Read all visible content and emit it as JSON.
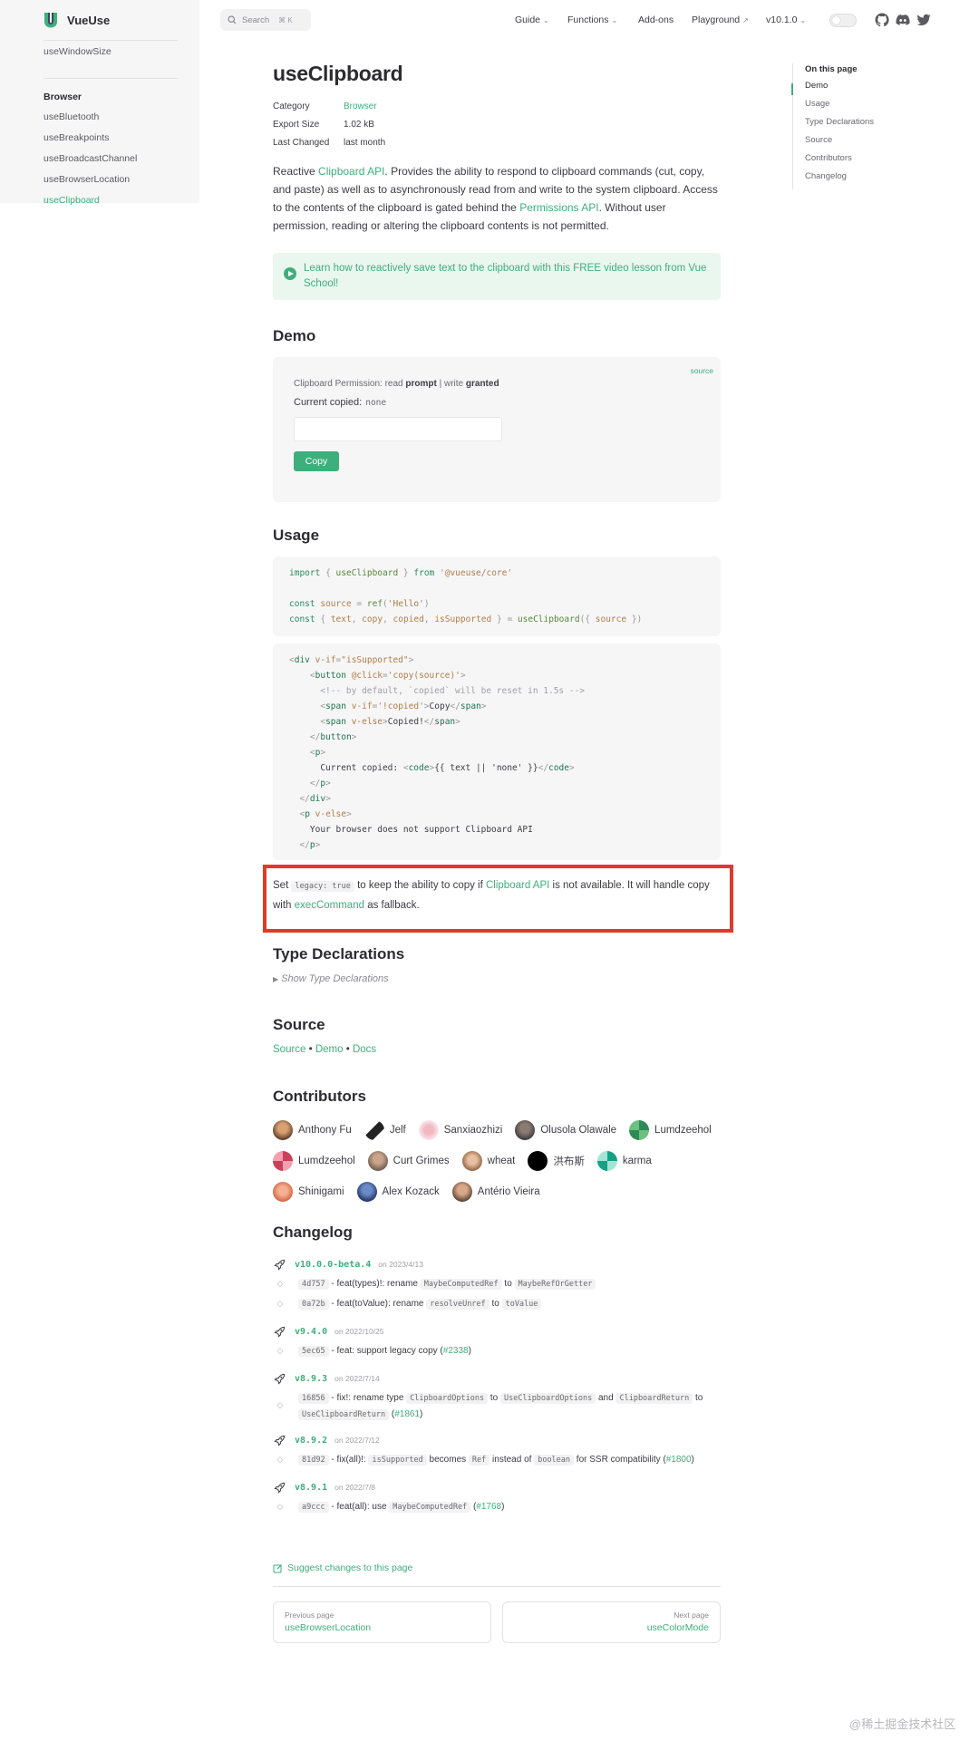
{
  "brand": {
    "name": "VueUse",
    "accent": "#3eaf7c"
  },
  "sidebar": {
    "top_item": "useWindowSize",
    "section": "Browser",
    "items": [
      {
        "label": "useBluetooth"
      },
      {
        "label": "useBreakpoints"
      },
      {
        "label": "useBroadcastChannel"
      },
      {
        "label": "useBrowserLocation"
      },
      {
        "label": "useClipboard",
        "active": true
      }
    ]
  },
  "nav": {
    "search_label": "Search",
    "search_shortcut": "⌘ K",
    "items": [
      "Guide",
      "Functions",
      "Add-ons",
      "Playground",
      "v10.1.0"
    ],
    "social": [
      "github-icon",
      "discord-icon",
      "twitter-icon"
    ]
  },
  "outline": {
    "title": "On this page",
    "items": [
      "Demo",
      "Usage",
      "Type Declarations",
      "Source",
      "Contributors",
      "Changelog"
    ]
  },
  "page": {
    "title": "useClipboard",
    "meta": [
      {
        "key": "Category",
        "value": "Browser"
      },
      {
        "key": "Export Size",
        "value": "1.02 kB"
      },
      {
        "key": "Last Changed",
        "value": "last month"
      }
    ],
    "intro": {
      "p1": "Reactive ",
      "link1": "Clipboard API",
      "p2": ". Provides the ability to respond to clipboard commands (cut, copy, and paste) as well as to asynchronously read from and write to the system clipboard. Access to the contents of the clipboard is gated behind the ",
      "link2": "Permissions API",
      "p3": ". Without user permission, reading or altering the clipboard contents is not permitted."
    },
    "tip": "Learn how to reactively save text to the clipboard with this FREE video lesson from Vue School!"
  },
  "demo": {
    "heading": "Demo",
    "source_link": "source",
    "perm_prefix": "Clipboard Permission: read ",
    "perm_read": "prompt",
    "perm_sep": " | write ",
    "perm_write": "granted",
    "current_label": "Current copied:",
    "current_value": "none",
    "input_value": "",
    "button": "Copy"
  },
  "usage": {
    "heading": "Usage"
  },
  "note": {
    "t1": "Set ",
    "code": "legacy: true",
    "t2": " to keep the ability to copy if ",
    "link1": "Clipboard API",
    "t3": " is not available. It will handle copy with ",
    "link2": "execCommand",
    "t4": " as fallback."
  },
  "type_decl": {
    "heading": "Type Declarations",
    "toggle": "Show Type Declarations"
  },
  "source": {
    "heading": "Source",
    "links": [
      "Source",
      "Demo",
      "Docs"
    ],
    "sep": " • "
  },
  "contributors": {
    "heading": "Contributors",
    "people": [
      "Anthony Fu",
      "Jelf",
      "Sanxiaozhizi",
      "Olusola Olawale",
      "Lumdzeehol",
      "Lumdzeehol",
      "Curt Grimes",
      "wheat",
      "洪布斯",
      "karma",
      "Shinigami",
      "Alex Kozack",
      "Antério Vieira"
    ]
  },
  "changelog": {
    "heading": "Changelog",
    "releases": [
      {
        "version": "v10.0.0-beta.4",
        "date": "on 2023/4/13"
      },
      {
        "version": "v9.4.0",
        "date": "on 2022/10/25"
      },
      {
        "version": "v8.9.3",
        "date": "on 2022/7/14"
      },
      {
        "version": "v8.9.2",
        "date": "on 2022/7/12"
      },
      {
        "version": "v8.9.1",
        "date": "on 2022/7/8"
      }
    ],
    "commits": {
      "c1": {
        "hash": "4d757",
        "a": " - feat(types)!: rename ",
        "c1": "MaybeComputedRef",
        "b": " to ",
        "c2": "MaybeRefOrGetter"
      },
      "c2": {
        "hash": "0a72b",
        "a": " - feat(toValue): rename ",
        "c1": "resolveUnref",
        "b": " to ",
        "c2": "toValue"
      },
      "c3": {
        "hash": "5ec65",
        "a": " - feat: support legacy copy (",
        "pr": "#2338",
        "b": ")"
      },
      "c4": {
        "hash": "16856",
        "a": " - fix!: rename type ",
        "c1": "ClipboardOptions",
        "b": " to ",
        "c2": "UseClipboardOptions",
        "c": " and ",
        "c3": "ClipboardReturn",
        "d": " to ",
        "c4": "UseClipboardReturn",
        "e": " (",
        "pr": "#1861",
        "f": ")"
      },
      "c5": {
        "hash": "81d92",
        "a": " - fix(all)!: ",
        "c1": "isSupported",
        "b": " becomes ",
        "c2": "Ref",
        "c": " instead of ",
        "c3": "boolean",
        "d": " for SSR compatibility (",
        "pr": "#1800",
        "e": ")"
      },
      "c6": {
        "hash": "a9ccc",
        "a": " - feat(all): use ",
        "c1": "MaybeComputedRef",
        "b": " (",
        "pr": "#1768",
        "c": ")"
      }
    }
  },
  "footer": {
    "suggest": "Suggest changes to this page",
    "prev_label": "Previous page",
    "prev_link": "useBrowserLocation",
    "next_label": "Next page",
    "next_link": "useColorMode"
  },
  "watermark": "@稀土掘金技术社区"
}
